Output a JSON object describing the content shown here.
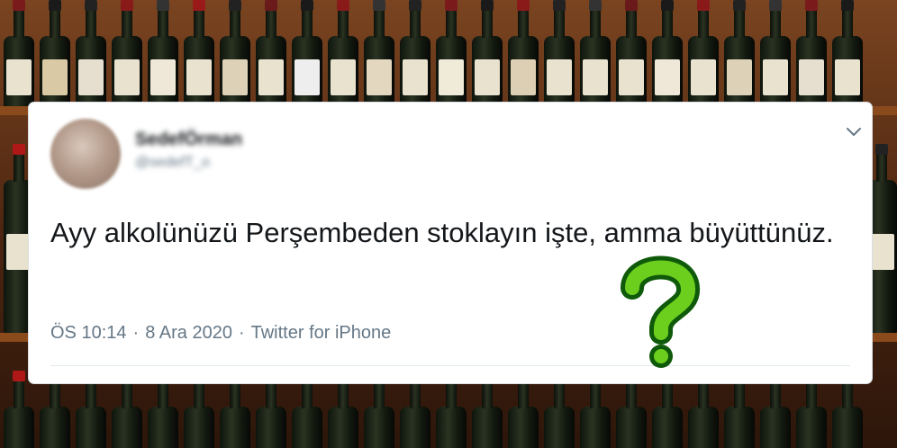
{
  "tweet": {
    "display_name": "SedefÖrman",
    "handle": "@sedefT_o",
    "text": "Ayy alkolünüzü Perşembeden stoklayın işte, amma büyüttünüz.",
    "time": "ÖS 10:14",
    "separator1": "·",
    "date": "8 Ara 2020",
    "separator2": "·",
    "source": "Twitter for iPhone"
  },
  "icons": {
    "menu": "chevron-down-icon",
    "overlay": "question-mark-icon"
  },
  "colors": {
    "text": "#14171a",
    "meta": "#657786",
    "overlay_green": "#6ccf1e"
  }
}
